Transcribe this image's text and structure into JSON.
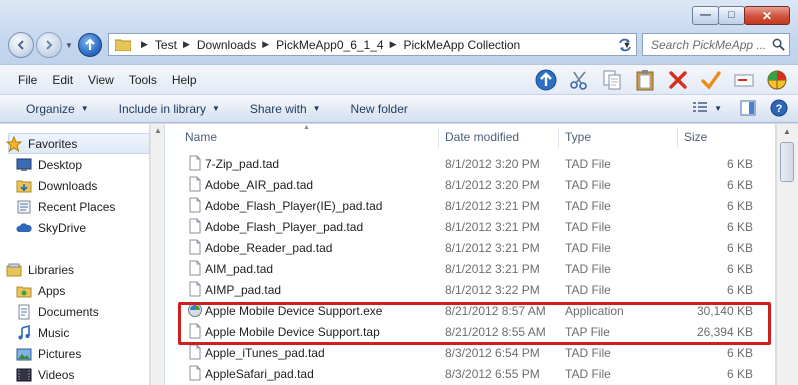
{
  "window": {
    "caption_buttons": [
      "minimize",
      "maximize",
      "close"
    ]
  },
  "address": {
    "crumbs": [
      "Test",
      "Downloads",
      "PickMeApp0_6_1_4",
      "PickMeApp Collection"
    ],
    "search_placeholder": "Search PickMeApp ..."
  },
  "menu": [
    "File",
    "Edit",
    "View",
    "Tools",
    "Help"
  ],
  "toolbar_icons": [
    "up-arrow-icon",
    "cut-icon",
    "copy-icon",
    "paste-icon",
    "delete-icon",
    "checkmark-icon",
    "rename-icon",
    "pickmeapp-logo-icon"
  ],
  "commands": {
    "organize": "Organize",
    "include_in_library": "Include in library",
    "share_with": "Share with",
    "new_folder": "New folder"
  },
  "navigation": {
    "favorites_header": "Favorites",
    "favorites": [
      "Desktop",
      "Downloads",
      "Recent Places",
      "SkyDrive"
    ],
    "libraries_header": "Libraries",
    "libraries": [
      "Apps",
      "Documents",
      "Music",
      "Pictures",
      "Videos"
    ]
  },
  "columns": {
    "name": "Name",
    "date_modified": "Date modified",
    "type": "Type",
    "size": "Size"
  },
  "files": [
    {
      "name": "7-Zip_pad.tad",
      "date": "8/1/2012 3:20 PM",
      "type": "TAD File",
      "size": "6 KB",
      "icon": "document-icon"
    },
    {
      "name": "Adobe_AIR_pad.tad",
      "date": "8/1/2012 3:20 PM",
      "type": "TAD File",
      "size": "6 KB",
      "icon": "document-icon"
    },
    {
      "name": "Adobe_Flash_Player(IE)_pad.tad",
      "date": "8/1/2012 3:21 PM",
      "type": "TAD File",
      "size": "6 KB",
      "icon": "document-icon"
    },
    {
      "name": "Adobe_Flash_Player_pad.tad",
      "date": "8/1/2012 3:21 PM",
      "type": "TAD File",
      "size": "6 KB",
      "icon": "document-icon"
    },
    {
      "name": "Adobe_Reader_pad.tad",
      "date": "8/1/2012 3:21 PM",
      "type": "TAD File",
      "size": "6 KB",
      "icon": "document-icon"
    },
    {
      "name": "AIM_pad.tad",
      "date": "8/1/2012 3:21 PM",
      "type": "TAD File",
      "size": "6 KB",
      "icon": "document-icon"
    },
    {
      "name": "AIMP_pad.tad",
      "date": "8/1/2012 3:22 PM",
      "type": "TAD File",
      "size": "6 KB",
      "icon": "document-icon"
    },
    {
      "name": "Apple Mobile Device Support.exe",
      "date": "8/21/2012 8:57 AM",
      "type": "Application",
      "size": "30,140 KB",
      "icon": "application-icon"
    },
    {
      "name": "Apple Mobile Device Support.tap",
      "date": "8/21/2012 8:55 AM",
      "type": "TAP File",
      "size": "26,394 KB",
      "icon": "document-icon"
    },
    {
      "name": "Apple_iTunes_pad.tad",
      "date": "8/3/2012 6:54 PM",
      "type": "TAD File",
      "size": "6 KB",
      "icon": "document-icon"
    },
    {
      "name": "AppleSafari_pad.tad",
      "date": "8/3/2012 6:55 PM",
      "type": "TAD File",
      "size": "6 KB",
      "icon": "document-icon"
    }
  ],
  "colors": {
    "highlight_border": "#cc1f1f",
    "chrome_blue": "#c6d8ef",
    "link_text": "#1e3a5f"
  }
}
